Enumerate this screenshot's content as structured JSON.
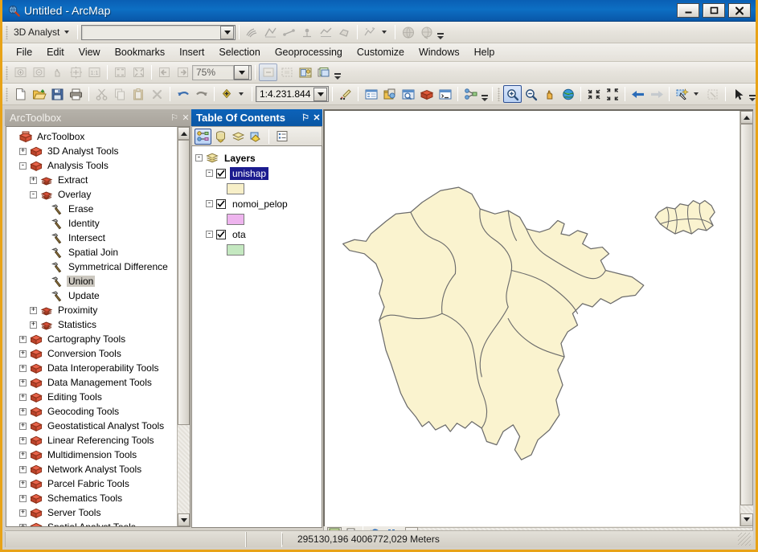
{
  "window": {
    "title": "Untitled - ArcMap",
    "app_icon": "arcmap-globe-icon",
    "minimize_label": "_",
    "maximize_label": "☐",
    "close_label": "✕"
  },
  "analyst_toolbar": {
    "name": "3D Analyst",
    "dropdown_label": "3D Analyst",
    "layer_combo_value": "",
    "buttons": [
      {
        "name": "contour-icon",
        "tip": "Contour"
      },
      {
        "name": "steepest-path-icon",
        "tip": "Steepest Path"
      },
      {
        "name": "line-of-sight-icon",
        "tip": "Line Of Sight"
      },
      {
        "name": "interpolate-point-icon",
        "tip": "Interpolate Point"
      },
      {
        "name": "interpolate-line-icon",
        "tip": "Interpolate Line"
      },
      {
        "name": "interpolate-polygon-icon",
        "tip": "Interpolate Polygon"
      },
      {
        "name": "create-profile-graph-icon",
        "tip": "Create Profile Graph"
      },
      {
        "name": "arcscene-icon",
        "tip": "ArcScene"
      },
      {
        "name": "arcglobe-icon",
        "tip": "ArcGlobe"
      }
    ]
  },
  "menubar": {
    "items": [
      {
        "label": "File"
      },
      {
        "label": "Edit"
      },
      {
        "label": "View"
      },
      {
        "label": "Bookmarks"
      },
      {
        "label": "Insert"
      },
      {
        "label": "Selection"
      },
      {
        "label": "Geoprocessing"
      },
      {
        "label": "Customize"
      },
      {
        "label": "Windows"
      },
      {
        "label": "Help"
      }
    ]
  },
  "layout_toolbar": {
    "zoom_value": "75%",
    "buttons": [
      {
        "name": "layout-zoom-in-icon"
      },
      {
        "name": "layout-zoom-out-icon"
      },
      {
        "name": "layout-pan-icon"
      },
      {
        "name": "zoom-whole-page-icon"
      },
      {
        "name": "zoom-100-percent-icon"
      },
      {
        "name": "fixed-zoom-in-icon"
      },
      {
        "name": "fixed-zoom-out-icon"
      },
      {
        "name": "go-back-extent-icon"
      },
      {
        "name": "go-forward-extent-icon"
      },
      {
        "name": "toggle-draft-mode-icon"
      },
      {
        "name": "focus-data-frame-icon"
      },
      {
        "name": "change-layout-icon"
      },
      {
        "name": "data-driven-pages-icon"
      }
    ]
  },
  "standard_toolbar": {
    "scale_value": "1:4.231.844",
    "buttons": [
      {
        "name": "new-document-icon"
      },
      {
        "name": "open-document-icon"
      },
      {
        "name": "save-document-icon"
      },
      {
        "name": "print-icon"
      },
      {
        "name": "cut-icon"
      },
      {
        "name": "copy-icon"
      },
      {
        "name": "paste-icon"
      },
      {
        "name": "delete-icon"
      },
      {
        "name": "undo-icon"
      },
      {
        "name": "redo-icon"
      },
      {
        "name": "add-data-icon"
      },
      {
        "name": "editor-toolbar-icon"
      },
      {
        "name": "table-of-contents-icon"
      },
      {
        "name": "catalog-window-icon"
      },
      {
        "name": "search-window-icon"
      },
      {
        "name": "arctoolbox-window-icon"
      },
      {
        "name": "python-window-icon"
      },
      {
        "name": "model-builder-icon"
      }
    ]
  },
  "tools_toolbar": {
    "buttons": [
      {
        "name": "zoom-in-tool-icon",
        "active": true
      },
      {
        "name": "zoom-out-tool-icon",
        "active": false
      },
      {
        "name": "pan-tool-icon",
        "active": false
      },
      {
        "name": "full-extent-icon",
        "active": false
      },
      {
        "name": "fixed-zoom-in-icon",
        "active": false
      },
      {
        "name": "fixed-zoom-out-icon",
        "active": false
      },
      {
        "name": "go-back-extent-icon",
        "active": false
      },
      {
        "name": "go-forward-extent-icon",
        "active": false
      },
      {
        "name": "select-features-icon",
        "active": false
      },
      {
        "name": "clear-selection-icon",
        "active": false
      },
      {
        "name": "select-elements-icon",
        "active": false
      }
    ]
  },
  "arctoolbox": {
    "title": "ArcToolbox",
    "pin_label": "⚐",
    "close_label": "✕",
    "tree": [
      {
        "label": "ArcToolbox",
        "indent": 0,
        "expander": "",
        "icon": "arctoolbox-root-icon",
        "selected": false
      },
      {
        "label": "3D Analyst Tools",
        "indent": 1,
        "expander": "+",
        "icon": "toolbox-icon",
        "selected": false
      },
      {
        "label": "Analysis Tools",
        "indent": 1,
        "expander": "-",
        "icon": "toolbox-icon",
        "selected": false
      },
      {
        "label": "Extract",
        "indent": 2,
        "expander": "+",
        "icon": "toolset-icon",
        "selected": false
      },
      {
        "label": "Overlay",
        "indent": 2,
        "expander": "-",
        "icon": "toolset-icon",
        "selected": false
      },
      {
        "label": "Erase",
        "indent": 3,
        "expander": "",
        "icon": "tool-hammer-icon",
        "selected": false
      },
      {
        "label": "Identity",
        "indent": 3,
        "expander": "",
        "icon": "tool-hammer-icon",
        "selected": false
      },
      {
        "label": "Intersect",
        "indent": 3,
        "expander": "",
        "icon": "tool-hammer-icon",
        "selected": false
      },
      {
        "label": "Spatial Join",
        "indent": 3,
        "expander": "",
        "icon": "tool-hammer-icon",
        "selected": false
      },
      {
        "label": "Symmetrical Difference",
        "indent": 3,
        "expander": "",
        "icon": "tool-hammer-icon",
        "selected": false
      },
      {
        "label": "Union",
        "indent": 3,
        "expander": "",
        "icon": "tool-hammer-icon",
        "selected": true
      },
      {
        "label": "Update",
        "indent": 3,
        "expander": "",
        "icon": "tool-hammer-icon",
        "selected": false
      },
      {
        "label": "Proximity",
        "indent": 2,
        "expander": "+",
        "icon": "toolset-icon",
        "selected": false
      },
      {
        "label": "Statistics",
        "indent": 2,
        "expander": "+",
        "icon": "toolset-icon",
        "selected": false
      },
      {
        "label": "Cartography Tools",
        "indent": 1,
        "expander": "+",
        "icon": "toolbox-icon",
        "selected": false
      },
      {
        "label": "Conversion Tools",
        "indent": 1,
        "expander": "+",
        "icon": "toolbox-icon",
        "selected": false
      },
      {
        "label": "Data Interoperability Tools",
        "indent": 1,
        "expander": "+",
        "icon": "toolbox-icon",
        "selected": false
      },
      {
        "label": "Data Management Tools",
        "indent": 1,
        "expander": "+",
        "icon": "toolbox-icon",
        "selected": false
      },
      {
        "label": "Editing Tools",
        "indent": 1,
        "expander": "+",
        "icon": "toolbox-icon",
        "selected": false
      },
      {
        "label": "Geocoding Tools",
        "indent": 1,
        "expander": "+",
        "icon": "toolbox-icon",
        "selected": false
      },
      {
        "label": "Geostatistical Analyst Tools",
        "indent": 1,
        "expander": "+",
        "icon": "toolbox-icon",
        "selected": false
      },
      {
        "label": "Linear Referencing Tools",
        "indent": 1,
        "expander": "+",
        "icon": "toolbox-icon",
        "selected": false
      },
      {
        "label": "Multidimension Tools",
        "indent": 1,
        "expander": "+",
        "icon": "toolbox-icon",
        "selected": false
      },
      {
        "label": "Network Analyst Tools",
        "indent": 1,
        "expander": "+",
        "icon": "toolbox-icon",
        "selected": false
      },
      {
        "label": "Parcel Fabric Tools",
        "indent": 1,
        "expander": "+",
        "icon": "toolbox-icon",
        "selected": false
      },
      {
        "label": "Schematics Tools",
        "indent": 1,
        "expander": "+",
        "icon": "toolbox-icon",
        "selected": false
      },
      {
        "label": "Server Tools",
        "indent": 1,
        "expander": "+",
        "icon": "toolbox-icon",
        "selected": false
      },
      {
        "label": "Spatial Analyst Tools",
        "indent": 1,
        "expander": "+",
        "icon": "toolbox-icon",
        "selected": false
      }
    ]
  },
  "table_of_contents": {
    "title": "Table Of Contents",
    "pin_label": "⚐",
    "close_label": "✕",
    "tabs": [
      {
        "name": "list-by-drawing-order-icon",
        "active": true
      },
      {
        "name": "list-by-source-icon",
        "active": false
      },
      {
        "name": "list-by-visibility-icon",
        "active": false
      },
      {
        "name": "list-by-selection-icon",
        "active": false
      },
      {
        "name": "toc-options-icon",
        "active": false
      }
    ],
    "root": {
      "label": "Layers",
      "expander": "-"
    },
    "layers": [
      {
        "label": "unishap",
        "checked": true,
        "selected": true,
        "expander": "-",
        "swatch": "#f7efc8"
      },
      {
        "label": "nomoi_pelop",
        "checked": true,
        "selected": false,
        "expander": "-",
        "swatch": "#eeb4ee"
      },
      {
        "label": "ota",
        "checked": true,
        "selected": false,
        "expander": "-",
        "swatch": "#c4e8c0"
      }
    ]
  },
  "map": {
    "background": "#ffffff",
    "polygon_fill": "#faf3cf",
    "polygon_stroke": "#6b6b6b",
    "footer_buttons": [
      {
        "name": "data-view-icon",
        "active": true
      },
      {
        "name": "layout-view-icon",
        "active": false
      },
      {
        "name": "refresh-view-icon",
        "active": false
      },
      {
        "name": "pause-drawing-icon",
        "active": false
      }
    ]
  },
  "statusbar": {
    "coordinates": "295130,196  4006772,029 Meters"
  }
}
